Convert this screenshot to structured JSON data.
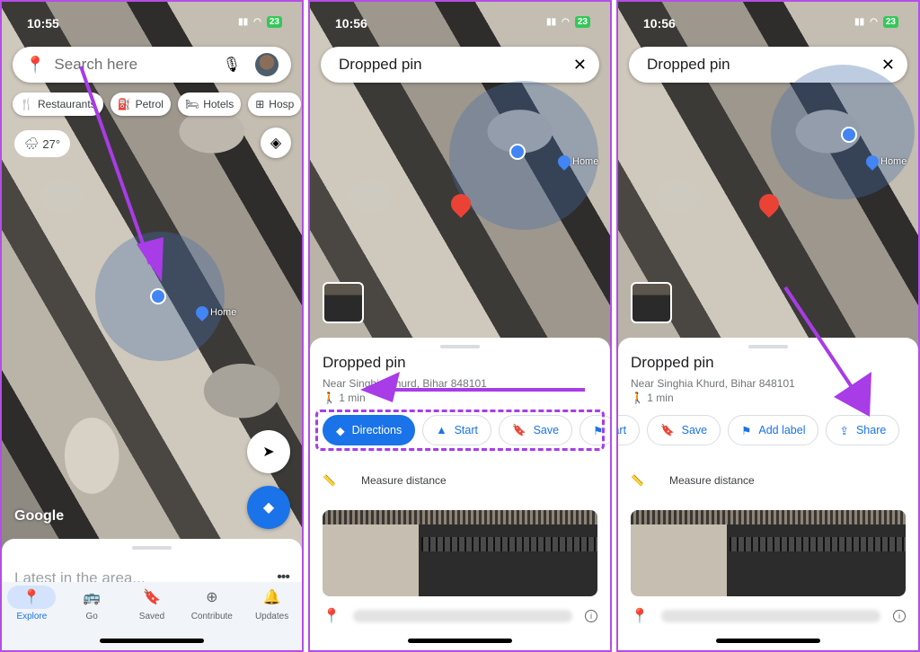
{
  "panels": [
    {
      "status": {
        "time": "10:55",
        "battery": "23"
      },
      "search": {
        "placeholder": "Search here"
      },
      "chips": [
        "Restaurants",
        "Petrol",
        "Hotels",
        "Hosp"
      ],
      "weather": "27°",
      "map": {
        "home_label": "Home",
        "attribution": "Google"
      },
      "sheet": {
        "title": "Latest in the area..."
      },
      "nav": [
        {
          "label": "Explore",
          "icon": "explore-pin-icon",
          "active": true
        },
        {
          "label": "Go",
          "icon": "commute-icon"
        },
        {
          "label": "Saved",
          "icon": "bookmark-icon"
        },
        {
          "label": "Contribute",
          "icon": "plus-circle-icon"
        },
        {
          "label": "Updates",
          "icon": "bell-icon"
        }
      ]
    },
    {
      "status": {
        "time": "10:56",
        "battery": "23"
      },
      "search": {
        "value": "Dropped pin"
      },
      "map": {
        "home_label": "Home"
      },
      "place": {
        "title": "Dropped pin",
        "address": "Near Singhia Khurd, Bihar 848101",
        "walk": "1 min"
      },
      "actions": [
        "Directions",
        "Start",
        "Save"
      ],
      "measure": "Measure distance"
    },
    {
      "status": {
        "time": "10:56",
        "battery": "23"
      },
      "search": {
        "value": "Dropped pin"
      },
      "map": {
        "home_label": "Home"
      },
      "place": {
        "title": "Dropped pin",
        "address": "Near Singhia Khurd, Bihar 848101",
        "walk": "1 min"
      },
      "actions": [
        "tart",
        "Save",
        "Add label",
        "Share"
      ],
      "measure": "Measure distance"
    }
  ],
  "colors": {
    "accent": "#1a73e8",
    "annotation": "#a83ce6",
    "pin_red": "#ea4335"
  }
}
